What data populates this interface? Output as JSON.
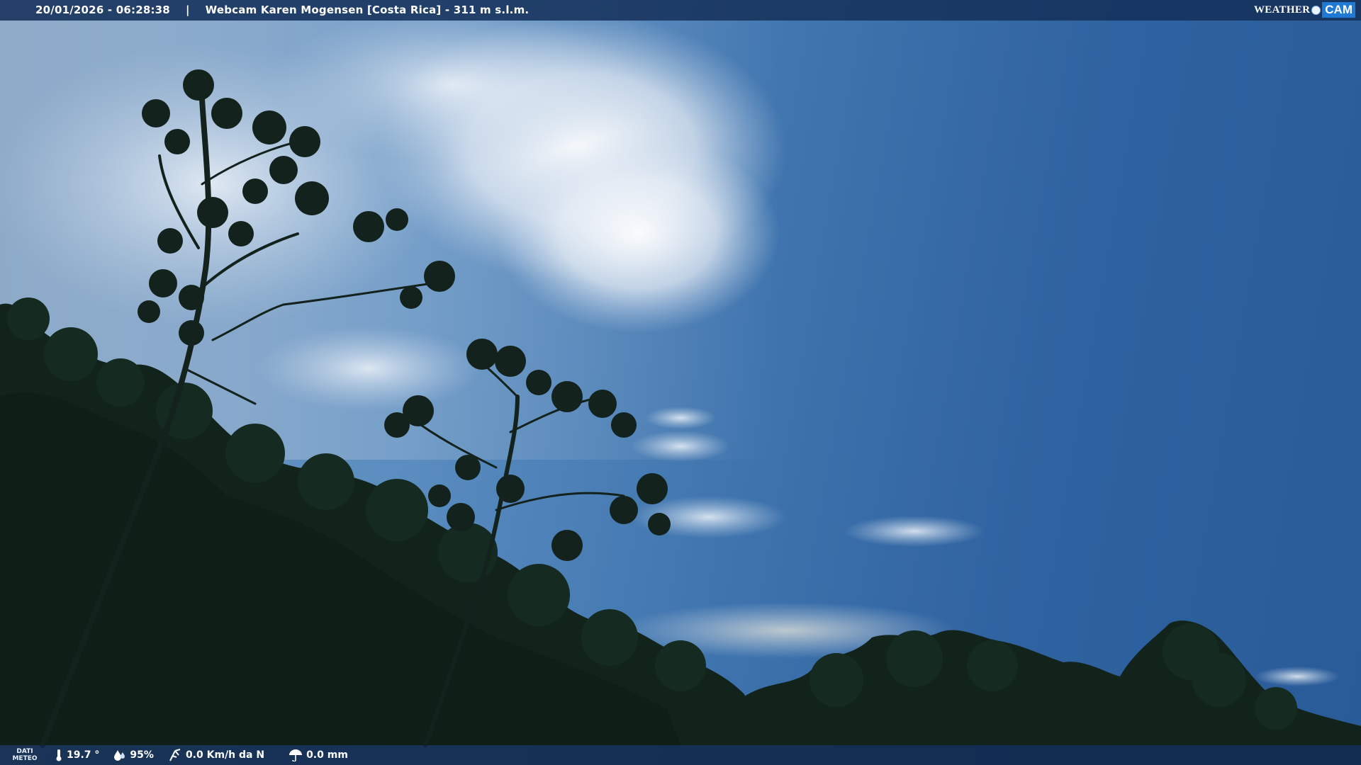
{
  "overlay": {
    "timestamp": "20/01/2026 - 06:28:38",
    "separator": "|",
    "camera_title": "Webcam Karen Mogensen [Costa Rica]  - 311 m s.l.m.",
    "logo_weather": "WEATHER",
    "logo_cam": "CAM"
  },
  "weather": {
    "panel_label_line1": "DATI",
    "panel_label_line2": "METEO",
    "temperature": "19.7 °",
    "humidity": "95%",
    "wind": "0.0 Km/h da N",
    "rain": "0.0 mm"
  },
  "icons": {
    "temperature": "thermometer-icon",
    "humidity": "humidity-drop-icon",
    "wind": "wind-vane-icon",
    "rain": "rain-umbrella-icon"
  },
  "colors": {
    "bar": "#142d55",
    "logo_accent": "#1f7ad6",
    "sky": "#3f74ae",
    "foliage": "#11221a"
  }
}
